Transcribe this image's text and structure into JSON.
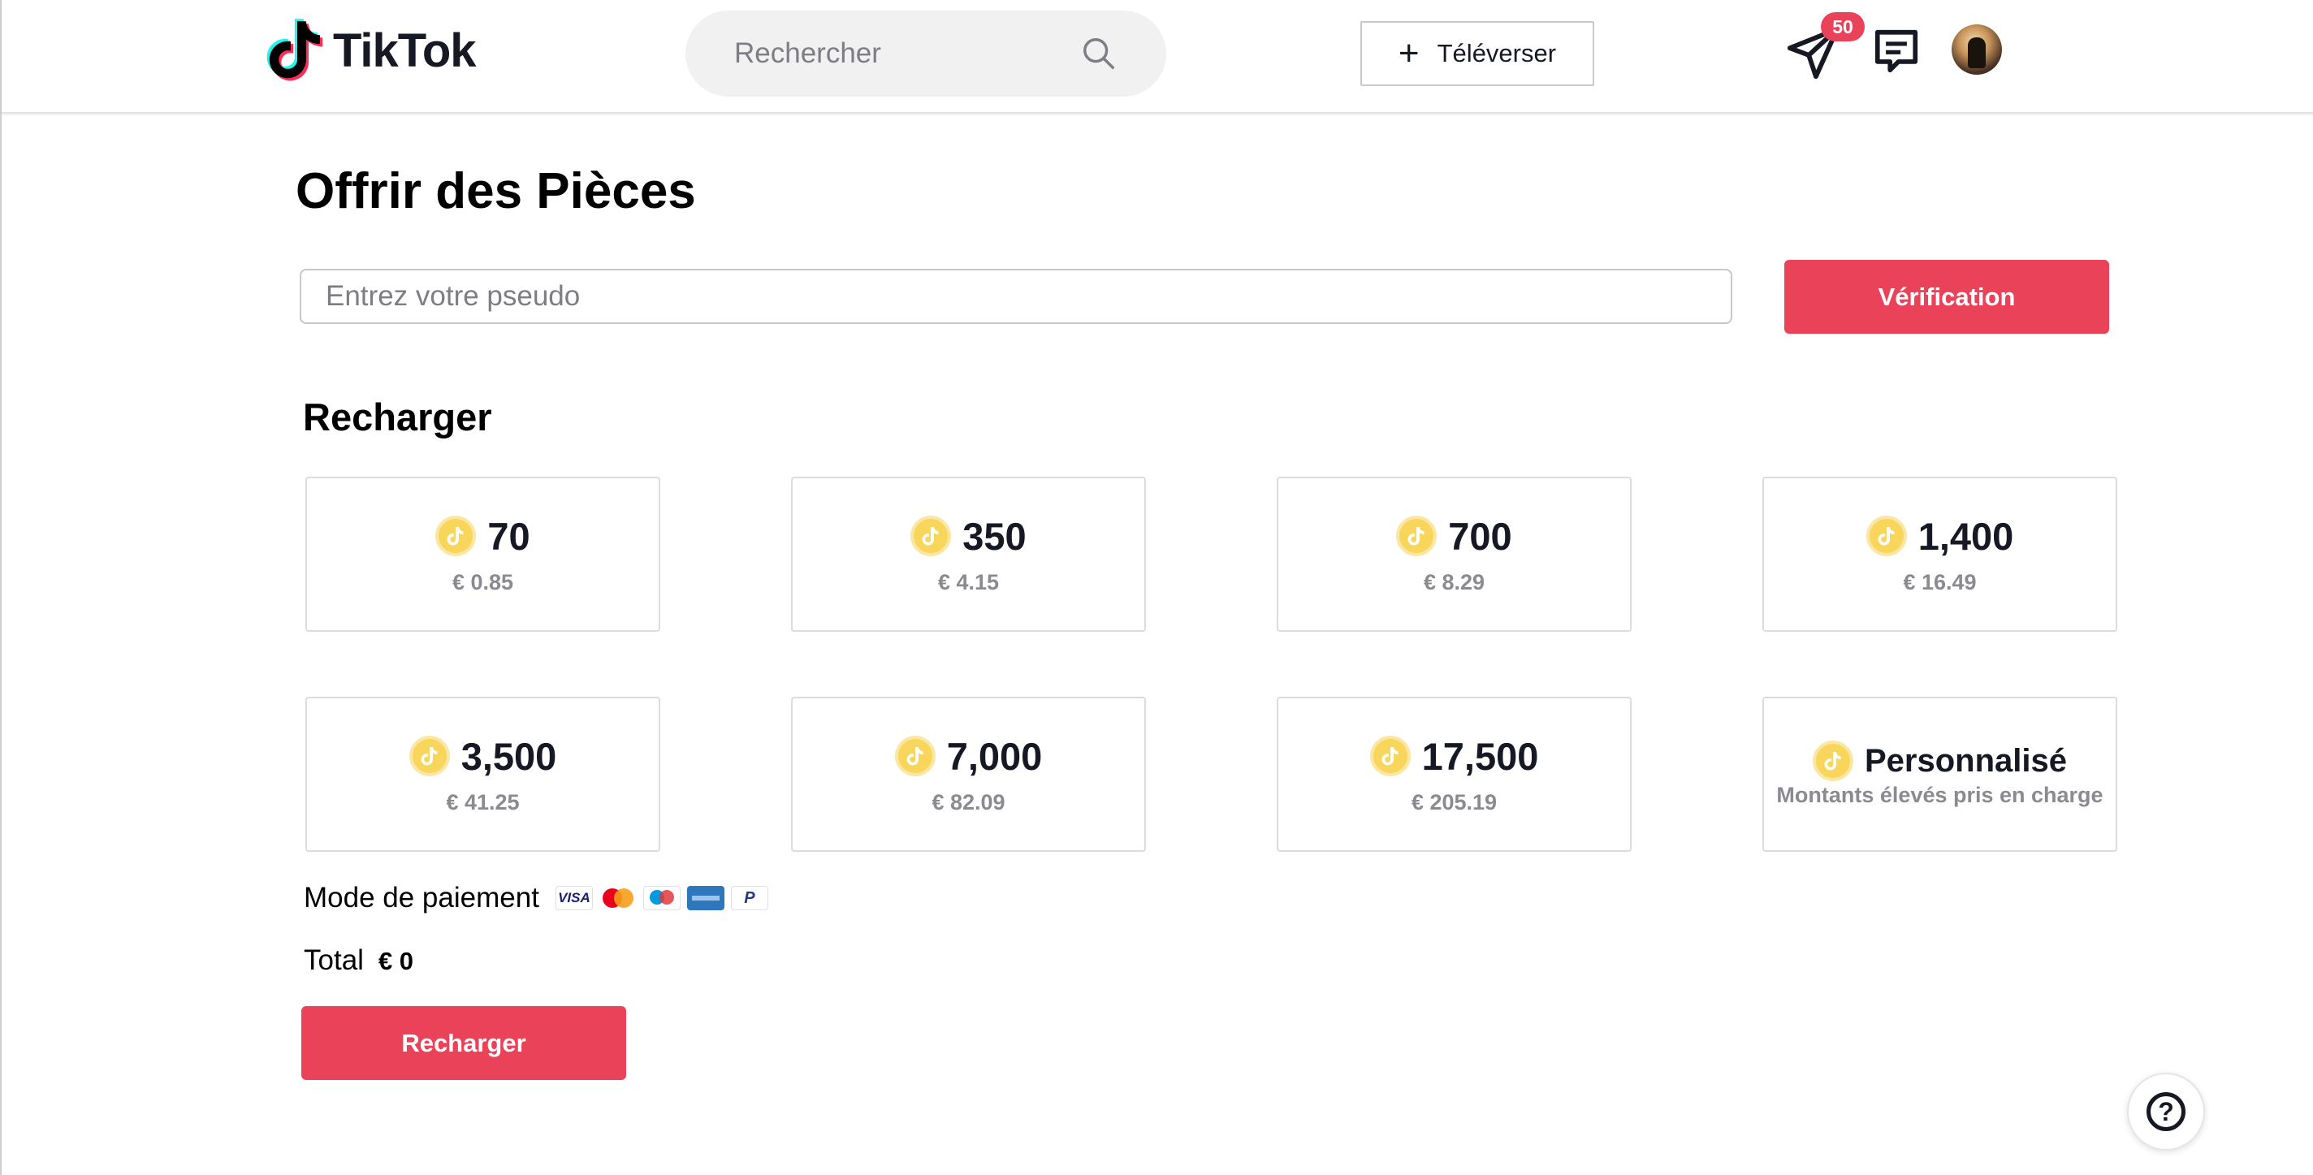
{
  "header": {
    "logo_text": "TikTok",
    "search_placeholder": "Rechercher",
    "upload_label": "Téléverser",
    "inbox_badge": "50"
  },
  "main": {
    "title": "Offrir des Pièces",
    "username_placeholder": "Entrez votre pseudo",
    "verify_label": "Vérification",
    "recharge_section_title": "Recharger",
    "packages": [
      {
        "coins": "70",
        "price": "€ 0.85"
      },
      {
        "coins": "350",
        "price": "€ 4.15"
      },
      {
        "coins": "700",
        "price": "€ 8.29"
      },
      {
        "coins": "1,400",
        "price": "€ 16.49"
      },
      {
        "coins": "3,500",
        "price": "€ 41.25"
      },
      {
        "coins": "7,000",
        "price": "€ 82.09"
      },
      {
        "coins": "17,500",
        "price": "€ 205.19"
      },
      {
        "coins": "Personnalisé",
        "price": "Montants élevés pris en charge"
      }
    ],
    "payment_label": "Mode de paiement",
    "payment_methods": {
      "visa": "VISA",
      "paypal": "P"
    },
    "total_label": "Total",
    "total_value": "€ 0",
    "recharge_button": "Recharger"
  },
  "help": {
    "symbol": "?"
  },
  "colors": {
    "accent": "#ea4359",
    "coin": "#f8d55b",
    "muted_text": "#8a8b91"
  },
  "icons": {
    "logo": "tiktok-logo-icon",
    "search": "search-icon",
    "upload": "plus-icon",
    "inbox": "paper-plane-icon",
    "messages": "message-icon",
    "coin": "coin-icon",
    "help": "help-icon"
  }
}
